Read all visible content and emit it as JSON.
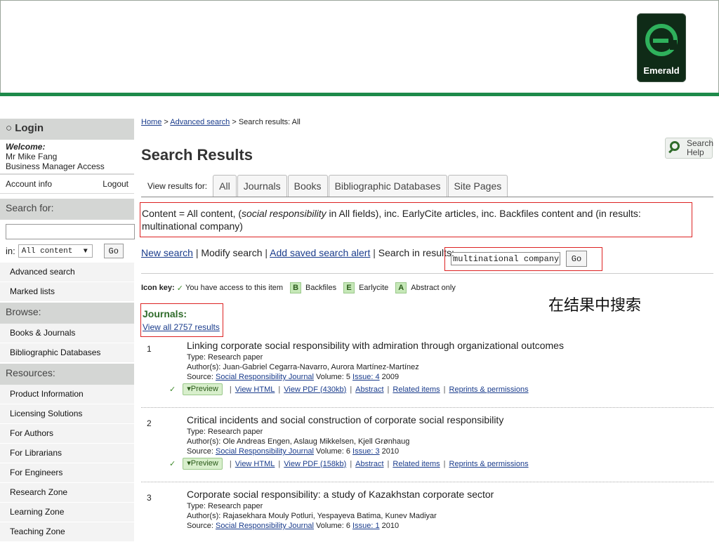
{
  "brand": {
    "logo_text": "Emerald"
  },
  "sidebar": {
    "login_label": "Login",
    "welcome": "Welcome:",
    "user_name": "Mr Mike Fang",
    "access": "Business Manager Access",
    "account_info": "Account info",
    "logout": "Logout",
    "search_heading": "Search for:",
    "search_value": "",
    "in_label": "in:",
    "scope_value": "All content",
    "go": "Go",
    "search_links": [
      "Advanced search",
      "Marked lists"
    ],
    "browse_heading": "Browse:",
    "browse_items": [
      "Books & Journals",
      "Bibliographic Databases"
    ],
    "resources_heading": "Resources:",
    "resource_items": [
      "Product Information",
      "Licensing Solutions",
      "For Authors",
      "For Librarians",
      "For Engineers",
      "Research Zone",
      "Learning Zone",
      "Teaching Zone"
    ]
  },
  "main": {
    "breadcrumb": {
      "home": "Home",
      "sep": " > ",
      "advanced": "Advanced search",
      "current": "Search results: All"
    },
    "title": "Search Results",
    "help": {
      "line1": "Search",
      "line2": "Help"
    },
    "tabs_label": "View results for:",
    "tabs": [
      "All",
      "Journals",
      "Books",
      "Bibliographic Databases",
      "Site Pages"
    ],
    "criteria": {
      "prefix": "Content = All content, (",
      "emph": "social responsibility",
      "suffix": " in All fields), inc. EarlyCite articles, inc. Backfiles content and (in results: multinational company)"
    },
    "actions": {
      "new_search": "New search",
      "modify": "Modify search",
      "add_alert": "Add saved search alert",
      "in_results_label": "Search in results:",
      "in_results_value": "multinational company",
      "go": "Go"
    },
    "icon_key": {
      "label": "Icon key:",
      "access": "You have access to this item",
      "backfiles_badge": "B",
      "backfiles": "Backfiles",
      "earlycite_badge": "E",
      "earlycite": "Earlycite",
      "abstract_badge": "A",
      "abstract": "Abstract only"
    },
    "annotation": "在结果中搜索",
    "journals_heading": "Journals:",
    "view_all": "View all 2757 results",
    "result_link_labels": {
      "preview": "▾Preview",
      "view_html": "View HTML",
      "abstract": "Abstract",
      "related": "Related items",
      "reprints": "Reprints & permissions"
    },
    "results": [
      {
        "num": "1",
        "title": "Linking corporate social responsibility with admiration through organizational outcomes",
        "type": "Type: Research paper",
        "authors": "Author(s): Juan-Gabriel Cegarra-Navarro, Aurora Martínez-Martínez",
        "source_label": "Source:",
        "journal": "Social Responsibility Journal",
        "volume": " Volume: 5 ",
        "issue": "Issue: 4",
        "year": " 2009",
        "pdf": "View PDF (430kb)"
      },
      {
        "num": "2",
        "title": "Critical incidents and social construction of corporate social responsibility",
        "type": "Type: Research paper",
        "authors": "Author(s): Ole Andreas Engen, Aslaug Mikkelsen, Kjell Grønhaug",
        "source_label": "Source:",
        "journal": "Social Responsibility Journal",
        "volume": " Volume: 6 ",
        "issue": "Issue: 3",
        "year": " 2010",
        "pdf": "View PDF (158kb)"
      },
      {
        "num": "3",
        "title": "Corporate social responsibility: a study of Kazakhstan corporate sector",
        "type": "Type: Research paper",
        "authors": "Author(s): Rajasekhara Mouly Potluri, Yespayeva Batima, Kunev Madiyar",
        "source_label": "Source:",
        "journal": "Social Responsibility Journal",
        "volume": " Volume: 6 ",
        "issue": "Issue: 1",
        "year": " 2010"
      }
    ]
  },
  "colors": {
    "accent_green": "#1e8a4a",
    "highlight_red": "#dd2222",
    "link_blue": "#1a3c8c",
    "logo_bg": "#0f2b17"
  }
}
